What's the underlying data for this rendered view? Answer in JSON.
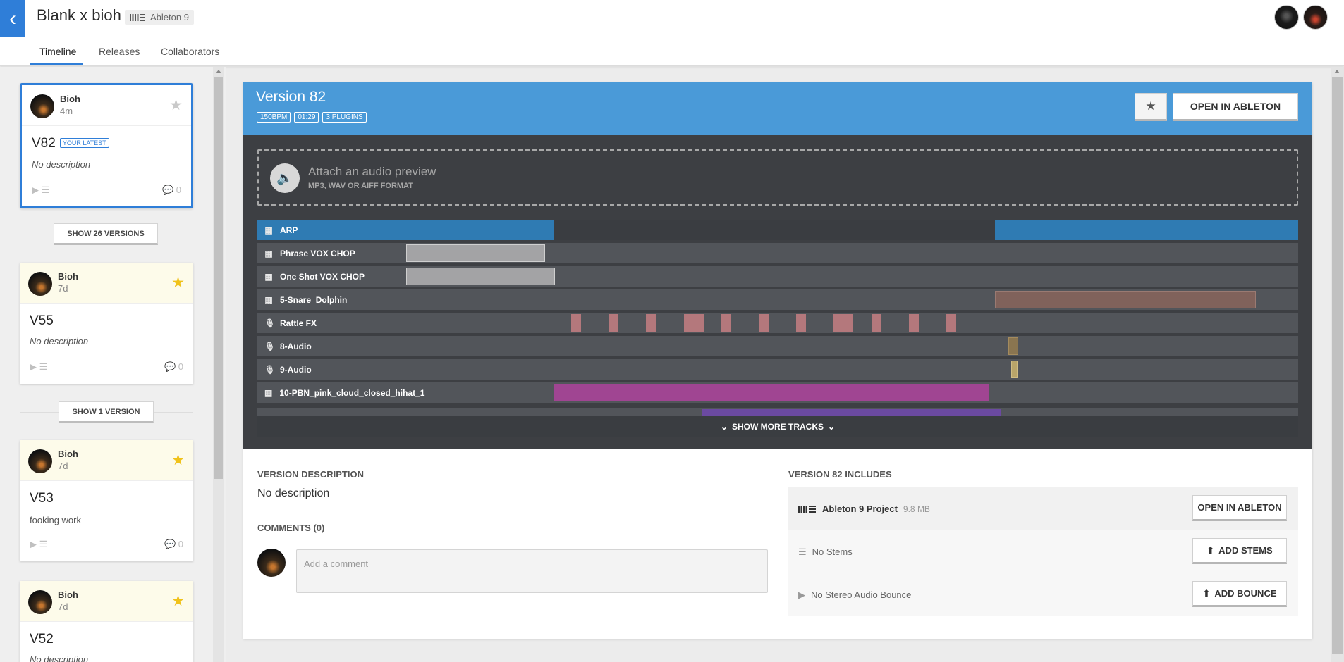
{
  "header": {
    "back_icon": "chevron-left-icon",
    "project_title": "Blank x bioh",
    "daw_badge": "Ableton 9",
    "tabs": [
      "Timeline",
      "Releases",
      "Collaborators"
    ],
    "active_tab": "Timeline"
  },
  "sidebar": {
    "versions": [
      {
        "user": "Bioh",
        "time": "4m",
        "name": "V82",
        "badge": "YOUR LATEST",
        "description": "No description",
        "comments": "0",
        "starred": false
      },
      {
        "user": "Bioh",
        "time": "7d",
        "name": "V55",
        "badge": "",
        "description": "No description",
        "comments": "0",
        "starred": true
      },
      {
        "user": "Bioh",
        "time": "7d",
        "name": "V53",
        "badge": "",
        "description": "fooking work",
        "comments": "0",
        "starred": true
      },
      {
        "user": "Bioh",
        "time": "7d",
        "name": "V52",
        "badge": "",
        "description": "No description",
        "comments": "",
        "starred": true
      }
    ],
    "show_buttons": [
      "SHOW 26 VERSIONS",
      "SHOW 1 VERSION"
    ]
  },
  "main": {
    "version_title": "Version 82",
    "chips": [
      "150BPM",
      "01:29",
      "3 PLUGINS"
    ],
    "open_button": "OPEN IN ABLETON",
    "audio_preview": {
      "title": "Attach an audio preview",
      "subtitle": "MP3, WAV OR AIFF FORMAT"
    },
    "tracks": [
      {
        "name": "ARP",
        "icon": "midi-icon",
        "active": true
      },
      {
        "name": "Phrase VOX CHOP",
        "icon": "midi-icon"
      },
      {
        "name": "One Shot VOX CHOP",
        "icon": "midi-icon"
      },
      {
        "name": "5-Snare_Dolphin",
        "icon": "midi-icon"
      },
      {
        "name": "Rattle FX",
        "icon": "mic-icon"
      },
      {
        "name": "8-Audio",
        "icon": "mic-icon"
      },
      {
        "name": "9-Audio",
        "icon": "mic-icon"
      },
      {
        "name": "10-PBN_pink_cloud_closed_hihat_1",
        "icon": "midi-icon"
      }
    ],
    "show_more_tracks": "SHOW MORE TRACKS",
    "description_heading": "VERSION DESCRIPTION",
    "description_text": "No description",
    "comments_heading": "COMMENTS (0)",
    "comment_placeholder": "Add a comment",
    "includes_heading": "VERSION 82 INCLUDES",
    "includes": [
      {
        "label": "Ableton 9 Project",
        "size": "9.8 MB",
        "button": "OPEN IN ABLETON"
      },
      {
        "label": "No Stems",
        "size": "",
        "button": "ADD STEMS"
      },
      {
        "label": "No Stereo Audio Bounce",
        "size": "",
        "button": "ADD BOUNCE"
      }
    ]
  },
  "colors": {
    "accent": "#2f7ed8",
    "version_header": "#4a9ad8",
    "star": "#f0c21a",
    "arp_clip": "#2f7bb3",
    "pink_clip": "#b4787c",
    "magenta_clip": "#a04592",
    "purple_clip": "#6b4aa1"
  }
}
